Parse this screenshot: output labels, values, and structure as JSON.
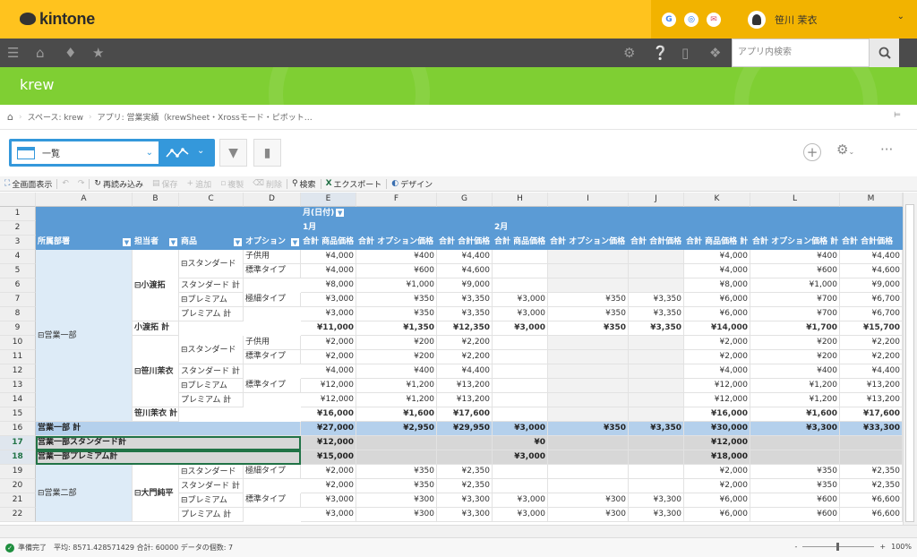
{
  "top": {
    "logo": "kintone",
    "user_name": "笹川 茉衣",
    "apps": [
      {
        "icon": "google-icon",
        "text": "G"
      },
      {
        "icon": "chrome-icon",
        "text": "◎"
      },
      {
        "icon": "mail-icon",
        "text": "✉"
      }
    ]
  },
  "nav": {
    "search_placeholder": "アプリ内検索"
  },
  "app": {
    "title": "krew"
  },
  "breadcrumb": {
    "space": "スペース: krew",
    "app": "アプリ: 営業実績（krewSheet・Xrossモード・ピボット…"
  },
  "view": {
    "name": "一覧"
  },
  "ktool": {
    "fullscreen": "全画面表示",
    "reload": "再読み込み",
    "save": "保存",
    "add": "追加",
    "copy": "複製",
    "delete": "削除",
    "search": "検索",
    "export": "エクスポート",
    "design": "デザイン"
  },
  "grid": {
    "col_letters": [
      "A",
      "B",
      "C",
      "D",
      "E",
      "F",
      "G",
      "H",
      "I",
      "J",
      "K",
      "L",
      "M"
    ],
    "row_numbers": [
      "1",
      "2",
      "3",
      "4",
      "5",
      "6",
      "7",
      "8",
      "9",
      "10",
      "11",
      "12",
      "13",
      "14",
      "15",
      "16",
      "17",
      "18",
      "19",
      "20",
      "21",
      "22"
    ],
    "month_field": "月(日付)",
    "month1": "1月",
    "month2": "2月",
    "headers": {
      "dept": "所属部署",
      "person": "担当者",
      "product": "商品",
      "option": "オプション",
      "sum_price": "合計 商品価格",
      "sum_opt": "合計 オプション価格",
      "sum_total": "合計 合計価格",
      "grand_price": "合計 商品価格 計",
      "grand_opt": "合計 オプション価格 計",
      "grand_total": "合計 合計価格"
    },
    "dept1": "⊟営業一部",
    "dept2": "⊟営業二部",
    "p1": "⊟小渡拓",
    "p1_total": "小渡拓 計",
    "p2": "⊟笹川茉衣",
    "p2_total": "笹川茉衣 計",
    "p3": "⊟大門純平",
    "std": "⊟スタンダード",
    "std_total": "スタンダード 計",
    "prem": "⊟プレミアム",
    "prem_total": "プレミアム 計",
    "opt_kids": "子供用",
    "opt_std": "標準タイプ",
    "opt_slim": "極細タイプ",
    "dept1_total": "営業一部 計",
    "dept1_std_total": "営業一部スタンダード計",
    "dept1_prem_total": "営業一部プレミアム計",
    "rows": {
      "r4": [
        "¥4,000",
        "¥400",
        "¥4,400",
        "",
        "",
        "",
        "¥4,000",
        "¥400",
        "¥4,400"
      ],
      "r5": [
        "¥4,000",
        "¥600",
        "¥4,600",
        "",
        "",
        "",
        "¥4,000",
        "¥600",
        "¥4,600"
      ],
      "r6": [
        "¥8,000",
        "¥1,000",
        "¥9,000",
        "",
        "",
        "",
        "¥8,000",
        "¥1,000",
        "¥9,000"
      ],
      "r7": [
        "¥3,000",
        "¥350",
        "¥3,350",
        "¥3,000",
        "¥350",
        "¥3,350",
        "¥6,000",
        "¥700",
        "¥6,700"
      ],
      "r8": [
        "¥3,000",
        "¥350",
        "¥3,350",
        "¥3,000",
        "¥350",
        "¥3,350",
        "¥6,000",
        "¥700",
        "¥6,700"
      ],
      "r9": [
        "¥11,000",
        "¥1,350",
        "¥12,350",
        "¥3,000",
        "¥350",
        "¥3,350",
        "¥14,000",
        "¥1,700",
        "¥15,700"
      ],
      "r10": [
        "¥2,000",
        "¥200",
        "¥2,200",
        "",
        "",
        "",
        "¥2,000",
        "¥200",
        "¥2,200"
      ],
      "r11": [
        "¥2,000",
        "¥200",
        "¥2,200",
        "",
        "",
        "",
        "¥2,000",
        "¥200",
        "¥2,200"
      ],
      "r12": [
        "¥4,000",
        "¥400",
        "¥4,400",
        "",
        "",
        "",
        "¥4,000",
        "¥400",
        "¥4,400"
      ],
      "r13": [
        "¥12,000",
        "¥1,200",
        "¥13,200",
        "",
        "",
        "",
        "¥12,000",
        "¥1,200",
        "¥13,200"
      ],
      "r14": [
        "¥12,000",
        "¥1,200",
        "¥13,200",
        "",
        "",
        "",
        "¥12,000",
        "¥1,200",
        "¥13,200"
      ],
      "r15": [
        "¥16,000",
        "¥1,600",
        "¥17,600",
        "",
        "",
        "",
        "¥16,000",
        "¥1,600",
        "¥17,600"
      ],
      "r16": [
        "¥27,000",
        "¥2,950",
        "¥29,950",
        "¥3,000",
        "¥350",
        "¥3,350",
        "¥30,000",
        "¥3,300",
        "¥33,300"
      ],
      "r17": [
        "¥12,000",
        "",
        "",
        "¥0",
        "",
        "",
        "¥12,000",
        "",
        ""
      ],
      "r18": [
        "¥15,000",
        "",
        "",
        "¥3,000",
        "",
        "",
        "¥18,000",
        "",
        ""
      ],
      "r19": [
        "¥2,000",
        "¥350",
        "¥2,350",
        "",
        "",
        "",
        "¥2,000",
        "¥350",
        "¥2,350"
      ],
      "r20": [
        "¥2,000",
        "¥350",
        "¥2,350",
        "",
        "",
        "",
        "¥2,000",
        "¥350",
        "¥2,350"
      ],
      "r21": [
        "¥3,000",
        "¥300",
        "¥3,300",
        "¥3,000",
        "¥300",
        "¥3,300",
        "¥6,000",
        "¥600",
        "¥6,600"
      ],
      "r22": [
        "¥3,000",
        "¥300",
        "¥3,300",
        "¥3,000",
        "¥300",
        "¥3,300",
        "¥6,000",
        "¥600",
        "¥6,600"
      ]
    }
  },
  "status": {
    "ready": "準備完了",
    "stats": "平均: 8571.428571429 合計: 60000 データの個数: 7",
    "zoom": "100%",
    "minus": "-",
    "plus": "+"
  }
}
